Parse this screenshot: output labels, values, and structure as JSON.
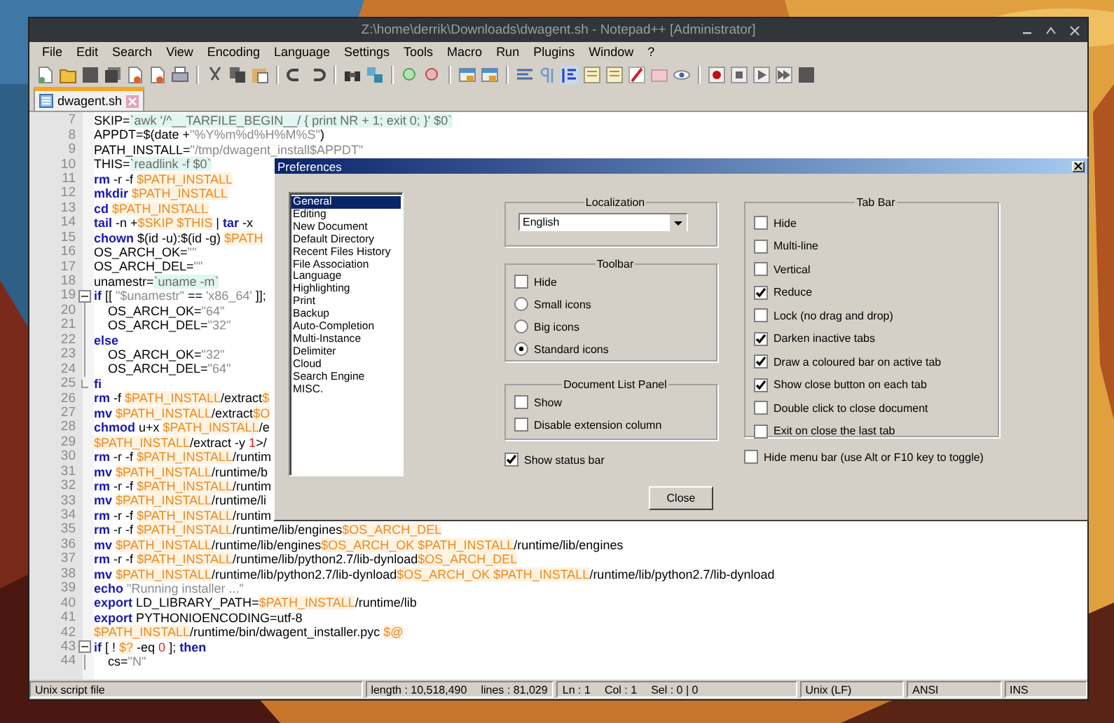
{
  "window": {
    "title": "Z:\\home\\derrik\\Downloads\\dwagent.sh - Notepad++ [Administrator]"
  },
  "menu": [
    "File",
    "Edit",
    "Search",
    "View",
    "Encoding",
    "Language",
    "Settings",
    "Tools",
    "Macro",
    "Run",
    "Plugins",
    "Window",
    "?"
  ],
  "tabs": [
    {
      "label": "dwagent.sh",
      "selected": true
    }
  ],
  "editor": {
    "lines": [
      {
        "number": "7",
        "fold_start": false,
        "in_fold": false,
        "segments": [
          {
            "kind": "text",
            "text": "SKIP="
          },
          {
            "kind": "command",
            "text": "`awk '/^__TARFILE_BEGIN__/ { print NR + 1; exit 0; }' $0`"
          }
        ]
      },
      {
        "number": "8",
        "fold_start": false,
        "in_fold": false,
        "segments": [
          {
            "kind": "text",
            "text": "APPDT=$(date +"
          },
          {
            "kind": "string",
            "text": "\"%Y%m%d%H%M%S\""
          },
          {
            "kind": "text",
            "text": ")"
          }
        ]
      },
      {
        "number": "9",
        "fold_start": false,
        "in_fold": false,
        "segments": [
          {
            "kind": "text",
            "text": "PATH_INSTALL="
          },
          {
            "kind": "string",
            "text": "\"/tmp/dwagent_install$APPDT\""
          }
        ]
      },
      {
        "number": "10",
        "fold_start": false,
        "in_fold": false,
        "segments": [
          {
            "kind": "text",
            "text": "THIS="
          },
          {
            "kind": "command",
            "text": "`readlink -f $0`"
          }
        ]
      },
      {
        "number": "11",
        "fold_start": false,
        "in_fold": false,
        "segments": [
          {
            "kind": "keyword",
            "text": "rm"
          },
          {
            "kind": "text",
            "text": " -r -f "
          },
          {
            "kind": "variable",
            "text": "$PATH_INSTALL"
          }
        ]
      },
      {
        "number": "12",
        "fold_start": false,
        "in_fold": false,
        "segments": [
          {
            "kind": "keyword",
            "text": "mkdir "
          },
          {
            "kind": "variable",
            "text": "$PATH_INSTALL"
          }
        ]
      },
      {
        "number": "13",
        "fold_start": false,
        "in_fold": false,
        "segments": [
          {
            "kind": "keyword",
            "text": "cd "
          },
          {
            "kind": "variable",
            "text": "$PATH_INSTALL"
          }
        ]
      },
      {
        "number": "14",
        "fold_start": false,
        "in_fold": false,
        "segments": [
          {
            "kind": "keyword",
            "text": "tail"
          },
          {
            "kind": "text",
            "text": " -n +"
          },
          {
            "kind": "variable",
            "text": "$SKIP $THIS"
          },
          {
            "kind": "text",
            "text": " | "
          },
          {
            "kind": "keyword",
            "text": "tar"
          },
          {
            "kind": "text",
            "text": " -x"
          }
        ]
      },
      {
        "number": "15",
        "fold_start": false,
        "in_fold": false,
        "segments": [
          {
            "kind": "keyword",
            "text": "chown"
          },
          {
            "kind": "text",
            "text": " $(id -u):$(id -g) "
          },
          {
            "kind": "variable",
            "text": "$PATH"
          }
        ]
      },
      {
        "number": "16",
        "fold_start": false,
        "in_fold": false,
        "segments": [
          {
            "kind": "text",
            "text": "OS_ARCH_OK="
          },
          {
            "kind": "string",
            "text": "\"\""
          }
        ]
      },
      {
        "number": "17",
        "fold_start": false,
        "in_fold": false,
        "segments": [
          {
            "kind": "text",
            "text": "OS_ARCH_DEL="
          },
          {
            "kind": "string",
            "text": "\"\""
          }
        ]
      },
      {
        "number": "18",
        "fold_start": false,
        "in_fold": false,
        "segments": [
          {
            "kind": "text",
            "text": "unamestr="
          },
          {
            "kind": "command",
            "text": "`uname -m`"
          }
        ]
      },
      {
        "number": "19",
        "fold_start": true,
        "in_fold": false,
        "segments": [
          {
            "kind": "keyword",
            "text": "if"
          },
          {
            "kind": "text",
            "text": " [[ "
          },
          {
            "kind": "string",
            "text": "\"$unamestr\""
          },
          {
            "kind": "text",
            "text": " == "
          },
          {
            "kind": "string",
            "text": "'x86_64'"
          },
          {
            "kind": "text",
            "text": " ]];"
          }
        ]
      },
      {
        "number": "20",
        "fold_start": false,
        "in_fold": true,
        "segments": [
          {
            "kind": "text",
            "text": "    OS_ARCH_OK="
          },
          {
            "kind": "string",
            "text": "\"64\""
          }
        ]
      },
      {
        "number": "21",
        "fold_start": false,
        "in_fold": true,
        "segments": [
          {
            "kind": "text",
            "text": "    OS_ARCH_DEL="
          },
          {
            "kind": "string",
            "text": "\"32\""
          }
        ]
      },
      {
        "number": "22",
        "fold_start": false,
        "in_fold": true,
        "segments": [
          {
            "kind": "keyword",
            "text": "else"
          }
        ]
      },
      {
        "number": "23",
        "fold_start": false,
        "in_fold": true,
        "segments": [
          {
            "kind": "text",
            "text": "    OS_ARCH_OK="
          },
          {
            "kind": "string",
            "text": "\"32\""
          }
        ]
      },
      {
        "number": "24",
        "fold_start": false,
        "in_fold": true,
        "segments": [
          {
            "kind": "text",
            "text": "    OS_ARCH_DEL="
          },
          {
            "kind": "string",
            "text": "\"64\""
          }
        ]
      },
      {
        "number": "25",
        "fold_start": false,
        "in_fold": true,
        "segments": [
          {
            "kind": "keyword",
            "text": "fi"
          }
        ]
      },
      {
        "number": "26",
        "fold_start": false,
        "in_fold": false,
        "segments": [
          {
            "kind": "keyword",
            "text": "rm"
          },
          {
            "kind": "text",
            "text": " -f "
          },
          {
            "kind": "variable",
            "text": "$PATH_INSTALL"
          },
          {
            "kind": "text",
            "text": "/extract"
          },
          {
            "kind": "variable",
            "text": "$"
          }
        ]
      },
      {
        "number": "27",
        "fold_start": false,
        "in_fold": false,
        "segments": [
          {
            "kind": "keyword",
            "text": "mv "
          },
          {
            "kind": "variable",
            "text": "$PATH_INSTALL"
          },
          {
            "kind": "text",
            "text": "/extract"
          },
          {
            "kind": "variable",
            "text": "$O"
          }
        ]
      },
      {
        "number": "28",
        "fold_start": false,
        "in_fold": false,
        "segments": [
          {
            "kind": "keyword",
            "text": "chmod"
          },
          {
            "kind": "text",
            "text": " u+x "
          },
          {
            "kind": "variable",
            "text": "$PATH_INSTALL"
          },
          {
            "kind": "text",
            "text": "/e"
          }
        ]
      },
      {
        "number": "29",
        "fold_start": false,
        "in_fold": false,
        "segments": [
          {
            "kind": "variable",
            "text": "$PATH_INSTALL"
          },
          {
            "kind": "text",
            "text": "/extract -y "
          },
          {
            "kind": "number",
            "text": "1"
          },
          {
            "kind": "text",
            "text": ">/"
          }
        ]
      },
      {
        "number": "30",
        "fold_start": false,
        "in_fold": false,
        "segments": [
          {
            "kind": "keyword",
            "text": "rm"
          },
          {
            "kind": "text",
            "text": " -r -f "
          },
          {
            "kind": "variable",
            "text": "$PATH_INSTALL"
          },
          {
            "kind": "text",
            "text": "/runtim"
          }
        ]
      },
      {
        "number": "31",
        "fold_start": false,
        "in_fold": false,
        "segments": [
          {
            "kind": "keyword",
            "text": "mv "
          },
          {
            "kind": "variable",
            "text": "$PATH_INSTALL"
          },
          {
            "kind": "text",
            "text": "/runtime/b"
          }
        ]
      },
      {
        "number": "32",
        "fold_start": false,
        "in_fold": false,
        "segments": [
          {
            "kind": "keyword",
            "text": "rm"
          },
          {
            "kind": "text",
            "text": " -r -f "
          },
          {
            "kind": "variable",
            "text": "$PATH_INSTALL"
          },
          {
            "kind": "text",
            "text": "/runtim"
          }
        ]
      },
      {
        "number": "33",
        "fold_start": false,
        "in_fold": false,
        "segments": [
          {
            "kind": "keyword",
            "text": "mv "
          },
          {
            "kind": "variable",
            "text": "$PATH_INSTALL"
          },
          {
            "kind": "text",
            "text": "/runtime/li"
          }
        ]
      },
      {
        "number": "34",
        "fold_start": false,
        "in_fold": false,
        "segments": [
          {
            "kind": "keyword",
            "text": "rm"
          },
          {
            "kind": "text",
            "text": " -r -f "
          },
          {
            "kind": "variable",
            "text": "$PATH_INSTALL"
          },
          {
            "kind": "text",
            "text": "/runtim"
          }
        ]
      },
      {
        "number": "35",
        "fold_start": false,
        "in_fold": false,
        "segments": [
          {
            "kind": "keyword",
            "text": "rm"
          },
          {
            "kind": "text",
            "text": " -r -f "
          },
          {
            "kind": "variable",
            "text": "$PATH_INSTALL"
          },
          {
            "kind": "text",
            "text": "/runtime/lib/engines"
          },
          {
            "kind": "variable",
            "text": "$OS_ARCH_DEL"
          }
        ]
      },
      {
        "number": "36",
        "fold_start": false,
        "in_fold": false,
        "segments": [
          {
            "kind": "keyword",
            "text": "mv "
          },
          {
            "kind": "variable",
            "text": "$PATH_INSTALL"
          },
          {
            "kind": "text",
            "text": "/runtime/lib/engines"
          },
          {
            "kind": "variable",
            "text": "$OS_ARCH_OK $PATH_INSTALL"
          },
          {
            "kind": "text",
            "text": "/runtime/lib/engines"
          }
        ]
      },
      {
        "number": "37",
        "fold_start": false,
        "in_fold": false,
        "segments": [
          {
            "kind": "keyword",
            "text": "rm"
          },
          {
            "kind": "text",
            "text": " -r -f "
          },
          {
            "kind": "variable",
            "text": "$PATH_INSTALL"
          },
          {
            "kind": "text",
            "text": "/runtime/lib/python2.7/lib-dynload"
          },
          {
            "kind": "variable",
            "text": "$OS_ARCH_DEL"
          }
        ]
      },
      {
        "number": "38",
        "fold_start": false,
        "in_fold": false,
        "segments": [
          {
            "kind": "keyword",
            "text": "mv "
          },
          {
            "kind": "variable",
            "text": "$PATH_INSTALL"
          },
          {
            "kind": "text",
            "text": "/runtime/lib/python2.7/lib-dynload"
          },
          {
            "kind": "variable",
            "text": "$OS_ARCH_OK $PATH_INSTALL"
          },
          {
            "kind": "text",
            "text": "/runtime/lib/python2.7/lib-dynload"
          }
        ]
      },
      {
        "number": "39",
        "fold_start": false,
        "in_fold": false,
        "segments": [
          {
            "kind": "keyword",
            "text": "echo "
          },
          {
            "kind": "string",
            "text": "\"Running installer ...\""
          }
        ]
      },
      {
        "number": "40",
        "fold_start": false,
        "in_fold": false,
        "segments": [
          {
            "kind": "keyword",
            "text": "export"
          },
          {
            "kind": "text",
            "text": " LD_LIBRARY_PATH="
          },
          {
            "kind": "variable",
            "text": "$PATH_INSTALL"
          },
          {
            "kind": "text",
            "text": "/runtime/lib"
          }
        ]
      },
      {
        "number": "41",
        "fold_start": false,
        "in_fold": false,
        "segments": [
          {
            "kind": "keyword",
            "text": "export"
          },
          {
            "kind": "text",
            "text": " PYTHONIOENCODING=utf-8"
          }
        ]
      },
      {
        "number": "42",
        "fold_start": false,
        "in_fold": false,
        "segments": [
          {
            "kind": "variable",
            "text": "$PATH_INSTALL"
          },
          {
            "kind": "text",
            "text": "/runtime/bin/dwagent_installer.pyc "
          },
          {
            "kind": "variable",
            "text": "$@"
          }
        ]
      },
      {
        "number": "43",
        "fold_start": true,
        "in_fold": false,
        "segments": [
          {
            "kind": "keyword",
            "text": "if"
          },
          {
            "kind": "text",
            "text": " [ ! "
          },
          {
            "kind": "variable",
            "text": "$?"
          },
          {
            "kind": "text",
            "text": " -eq "
          },
          {
            "kind": "number",
            "text": "0"
          },
          {
            "kind": "text",
            "text": " ]; "
          },
          {
            "kind": "keyword",
            "text": "then"
          }
        ]
      },
      {
        "number": "44",
        "fold_start": false,
        "in_fold": true,
        "segments": [
          {
            "kind": "text",
            "text": "    cs="
          },
          {
            "kind": "string",
            "text": "\"N\""
          }
        ]
      }
    ]
  },
  "preferences": {
    "title": "Preferences",
    "categories": [
      {
        "label": "General",
        "selected": true
      },
      {
        "label": "Editing",
        "selected": false
      },
      {
        "label": "New Document",
        "selected": false
      },
      {
        "label": "Default Directory",
        "selected": false
      },
      {
        "label": "Recent Files History",
        "selected": false
      },
      {
        "label": "File Association",
        "selected": false
      },
      {
        "label": "Language",
        "selected": false
      },
      {
        "label": "Highlighting",
        "selected": false
      },
      {
        "label": "Print",
        "selected": false
      },
      {
        "label": "Backup",
        "selected": false
      },
      {
        "label": "Auto-Completion",
        "selected": false
      },
      {
        "label": "Multi-Instance",
        "selected": false
      },
      {
        "label": "Delimiter",
        "selected": false
      },
      {
        "label": "Cloud",
        "selected": false
      },
      {
        "label": "Search Engine",
        "selected": false
      },
      {
        "label": "MISC.",
        "selected": false
      }
    ],
    "localization": {
      "title": "Localization",
      "language": "English"
    },
    "toolbar": {
      "title": "Toolbar",
      "hide": {
        "label": "Hide",
        "checked": false
      },
      "sizes": [
        {
          "label": "Small icons",
          "selected": false
        },
        {
          "label": "Big icons",
          "selected": false
        },
        {
          "label": "Standard icons",
          "selected": true
        }
      ]
    },
    "document_list_panel": {
      "title": "Document List Panel",
      "options": [
        {
          "label": "Show",
          "checked": false
        },
        {
          "label": "Disable extension column",
          "checked": false
        }
      ]
    },
    "show_status_bar": {
      "label": "Show status bar",
      "checked": true
    },
    "tab_bar": {
      "title": "Tab Bar",
      "options": [
        {
          "label": "Hide",
          "checked": false
        },
        {
          "label": "Multi-line",
          "checked": false
        },
        {
          "label": "Vertical",
          "checked": false
        },
        {
          "label": "Reduce",
          "checked": true
        },
        {
          "label": "Lock (no drag and drop)",
          "checked": false
        },
        {
          "label": "Darken inactive tabs",
          "checked": true
        },
        {
          "label": "Draw a coloured bar on active tab",
          "checked": true
        },
        {
          "label": "Show close button on each tab",
          "checked": true
        },
        {
          "label": "Double click to close document",
          "checked": false
        },
        {
          "label": "Exit on close the last tab",
          "checked": false
        }
      ]
    },
    "hide_menu_bar": {
      "label": "Hide menu bar (use Alt or F10 key to toggle)",
      "checked": false
    },
    "close_button": "Close"
  },
  "status_bar": [
    [
      "Unix script file"
    ],
    [
      "length : 10,518,490",
      "lines : 81,029"
    ],
    [
      "Ln : 1",
      "Col : 1",
      "Sel : 0 | 0"
    ],
    [
      "Unix (LF)"
    ],
    [
      "ANSI"
    ],
    [
      "INS"
    ]
  ]
}
